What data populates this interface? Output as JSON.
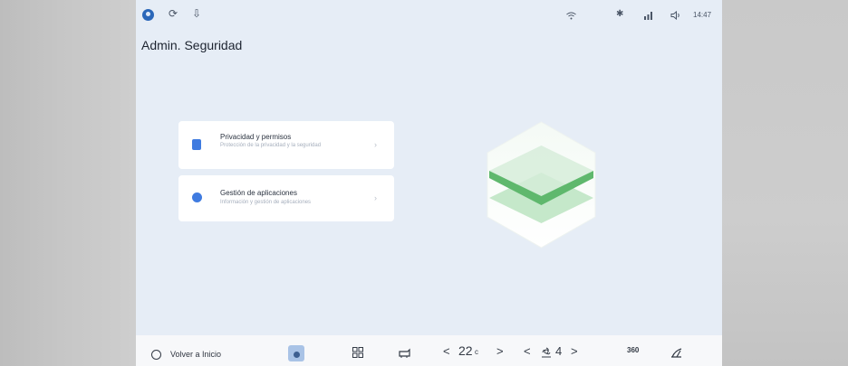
{
  "status_bar": {
    "time": "14:47",
    "icons": [
      "profile-icon",
      "sync-icon",
      "download-icon",
      "wifi-icon",
      "bluetooth-icon",
      "signal-icon",
      "volume-icon"
    ]
  },
  "page": {
    "title": "Admin. Seguridad"
  },
  "cards": [
    {
      "title": "Privacidad y permisos",
      "subtitle": "Protección de la privacidad y la seguridad",
      "icon": "privacy-icon"
    },
    {
      "title": "Gestión de aplicaciones",
      "subtitle": "Información y gestión de aplicaciones",
      "icon": "apps-icon"
    }
  ],
  "bottom_bar": {
    "home_label": "Volver a Inicio",
    "temperature": "22",
    "temperature_unit": "c",
    "fan_level": "4",
    "view_360": "360",
    "prev": "<",
    "next": ">"
  },
  "colors": {
    "screen_bg": "#e6edf6",
    "accent_blue": "#3f7be0",
    "hex_green_dark": "#5fb86d",
    "hex_green_light": "#b8e2bd"
  }
}
